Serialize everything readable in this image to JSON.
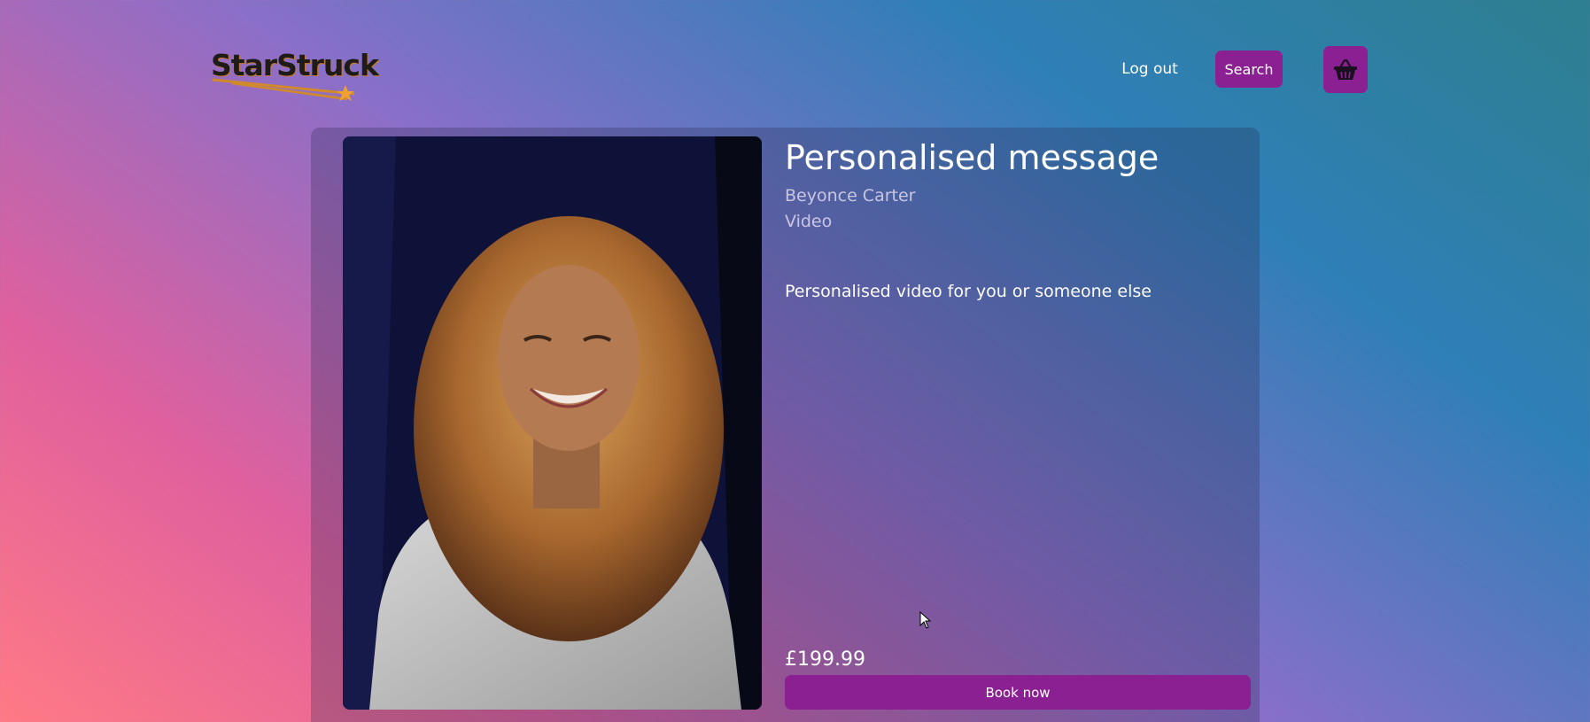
{
  "brand": {
    "logo_text": "StarStruck"
  },
  "nav": {
    "logout_label": "Log out",
    "search_label": "Search",
    "basket_icon": "basket-icon"
  },
  "product": {
    "title": "Personalised message",
    "celebrity": "Beyonce Carter",
    "type": "Video",
    "description": "Personalised video for you or someone else",
    "price": "£199.99",
    "book_label": "Book now"
  },
  "colors": {
    "accent": "#8b2092",
    "background_gradient": [
      "#ff7a85",
      "#e0609e",
      "#8a6fc8",
      "#2f7fb8",
      "#2e7f8f"
    ]
  }
}
